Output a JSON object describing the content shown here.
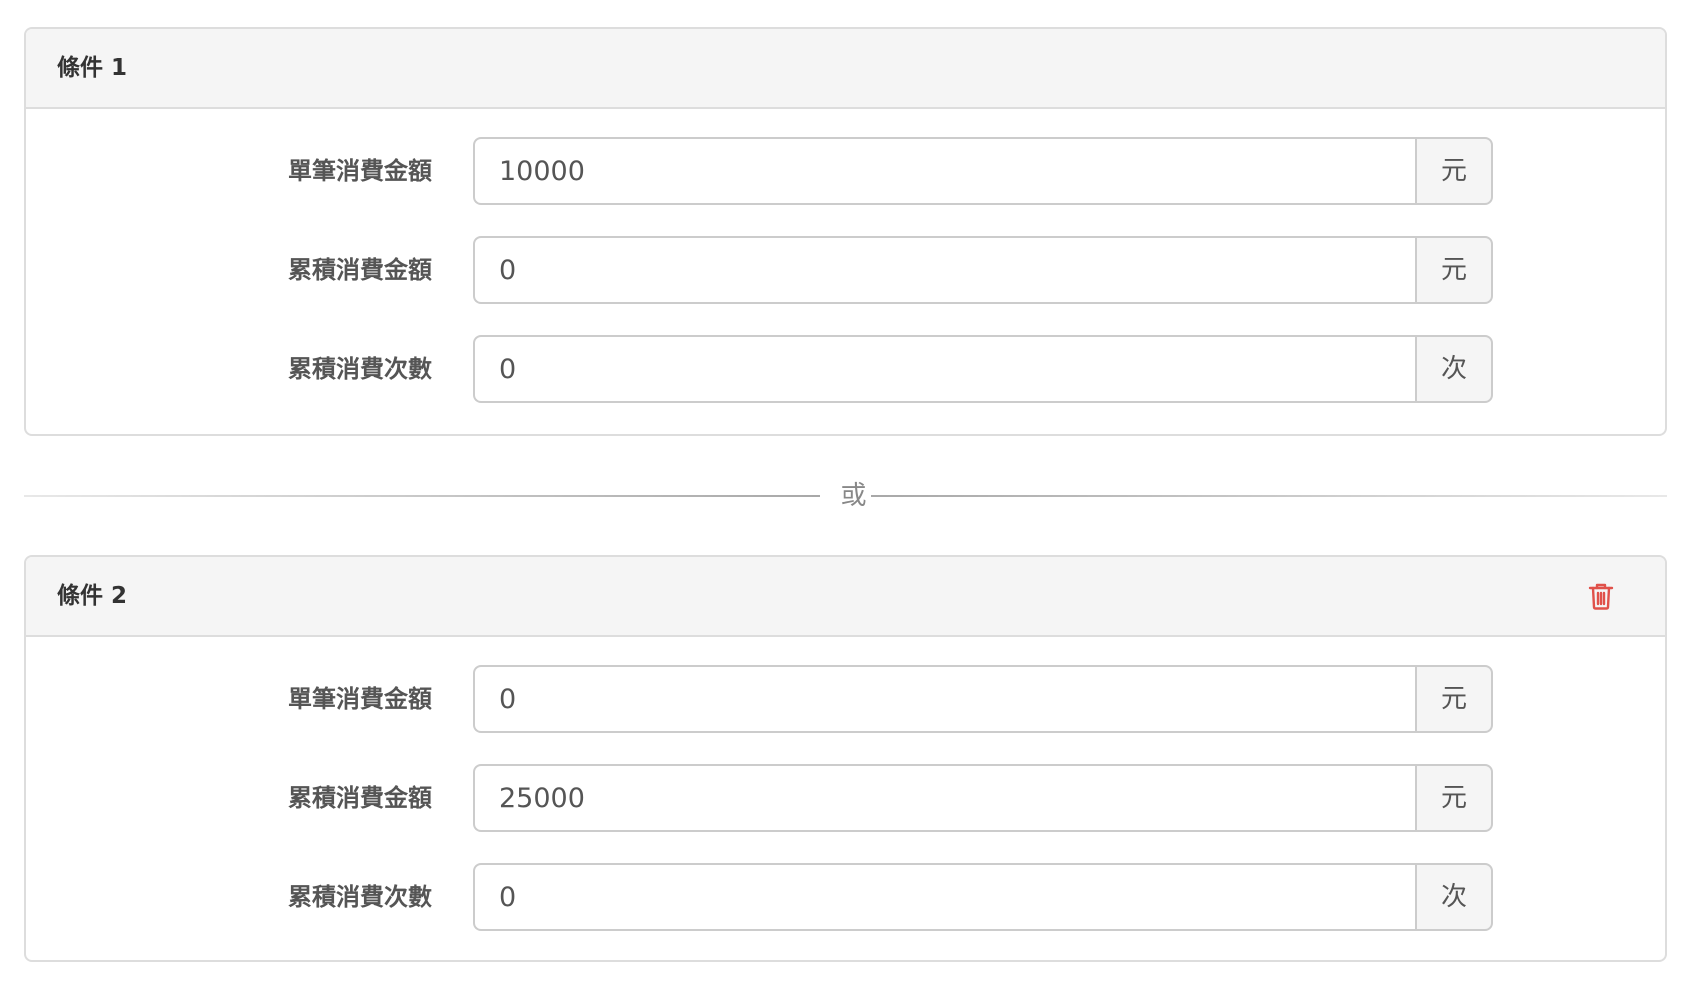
{
  "conditions": [
    {
      "title": "條件 1",
      "fields": [
        {
          "label": "單筆消費金額",
          "value": "10000",
          "unit": "元"
        },
        {
          "label": "累積消費金額",
          "value": "0",
          "unit": "元"
        },
        {
          "label": "累積消費次數",
          "value": "0",
          "unit": "次"
        }
      ],
      "deletable": false
    },
    {
      "title": "條件 2",
      "fields": [
        {
          "label": "單筆消費金額",
          "value": "0",
          "unit": "元"
        },
        {
          "label": "累積消費金額",
          "value": "25000",
          "unit": "元"
        },
        {
          "label": "累積消費次數",
          "value": "0",
          "unit": "次"
        }
      ],
      "deletable": true,
      "delete_icon": "trash-icon"
    }
  ],
  "divider": {
    "text": "或"
  },
  "colors": {
    "delete_icon": "#e0514a",
    "panel_header_bg": "#f5f5f5",
    "border": "#dddddd",
    "input_border": "#cccccc"
  }
}
